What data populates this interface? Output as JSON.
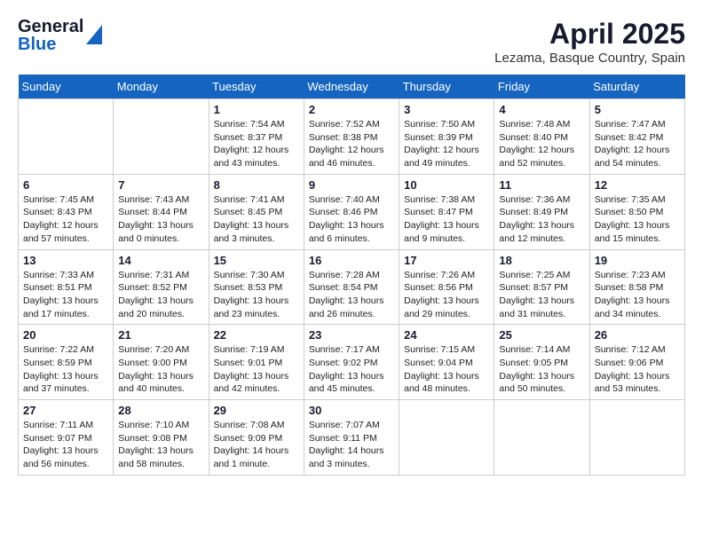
{
  "header": {
    "logo_general": "General",
    "logo_blue": "Blue",
    "month": "April 2025",
    "location": "Lezama, Basque Country, Spain"
  },
  "weekdays": [
    "Sunday",
    "Monday",
    "Tuesday",
    "Wednesday",
    "Thursday",
    "Friday",
    "Saturday"
  ],
  "weeks": [
    [
      {
        "day": "",
        "info": ""
      },
      {
        "day": "",
        "info": ""
      },
      {
        "day": "1",
        "info": "Sunrise: 7:54 AM\nSunset: 8:37 PM\nDaylight: 12 hours and 43 minutes."
      },
      {
        "day": "2",
        "info": "Sunrise: 7:52 AM\nSunset: 8:38 PM\nDaylight: 12 hours and 46 minutes."
      },
      {
        "day": "3",
        "info": "Sunrise: 7:50 AM\nSunset: 8:39 PM\nDaylight: 12 hours and 49 minutes."
      },
      {
        "day": "4",
        "info": "Sunrise: 7:48 AM\nSunset: 8:40 PM\nDaylight: 12 hours and 52 minutes."
      },
      {
        "day": "5",
        "info": "Sunrise: 7:47 AM\nSunset: 8:42 PM\nDaylight: 12 hours and 54 minutes."
      }
    ],
    [
      {
        "day": "6",
        "info": "Sunrise: 7:45 AM\nSunset: 8:43 PM\nDaylight: 12 hours and 57 minutes."
      },
      {
        "day": "7",
        "info": "Sunrise: 7:43 AM\nSunset: 8:44 PM\nDaylight: 13 hours and 0 minutes."
      },
      {
        "day": "8",
        "info": "Sunrise: 7:41 AM\nSunset: 8:45 PM\nDaylight: 13 hours and 3 minutes."
      },
      {
        "day": "9",
        "info": "Sunrise: 7:40 AM\nSunset: 8:46 PM\nDaylight: 13 hours and 6 minutes."
      },
      {
        "day": "10",
        "info": "Sunrise: 7:38 AM\nSunset: 8:47 PM\nDaylight: 13 hours and 9 minutes."
      },
      {
        "day": "11",
        "info": "Sunrise: 7:36 AM\nSunset: 8:49 PM\nDaylight: 13 hours and 12 minutes."
      },
      {
        "day": "12",
        "info": "Sunrise: 7:35 AM\nSunset: 8:50 PM\nDaylight: 13 hours and 15 minutes."
      }
    ],
    [
      {
        "day": "13",
        "info": "Sunrise: 7:33 AM\nSunset: 8:51 PM\nDaylight: 13 hours and 17 minutes."
      },
      {
        "day": "14",
        "info": "Sunrise: 7:31 AM\nSunset: 8:52 PM\nDaylight: 13 hours and 20 minutes."
      },
      {
        "day": "15",
        "info": "Sunrise: 7:30 AM\nSunset: 8:53 PM\nDaylight: 13 hours and 23 minutes."
      },
      {
        "day": "16",
        "info": "Sunrise: 7:28 AM\nSunset: 8:54 PM\nDaylight: 13 hours and 26 minutes."
      },
      {
        "day": "17",
        "info": "Sunrise: 7:26 AM\nSunset: 8:56 PM\nDaylight: 13 hours and 29 minutes."
      },
      {
        "day": "18",
        "info": "Sunrise: 7:25 AM\nSunset: 8:57 PM\nDaylight: 13 hours and 31 minutes."
      },
      {
        "day": "19",
        "info": "Sunrise: 7:23 AM\nSunset: 8:58 PM\nDaylight: 13 hours and 34 minutes."
      }
    ],
    [
      {
        "day": "20",
        "info": "Sunrise: 7:22 AM\nSunset: 8:59 PM\nDaylight: 13 hours and 37 minutes."
      },
      {
        "day": "21",
        "info": "Sunrise: 7:20 AM\nSunset: 9:00 PM\nDaylight: 13 hours and 40 minutes."
      },
      {
        "day": "22",
        "info": "Sunrise: 7:19 AM\nSunset: 9:01 PM\nDaylight: 13 hours and 42 minutes."
      },
      {
        "day": "23",
        "info": "Sunrise: 7:17 AM\nSunset: 9:02 PM\nDaylight: 13 hours and 45 minutes."
      },
      {
        "day": "24",
        "info": "Sunrise: 7:15 AM\nSunset: 9:04 PM\nDaylight: 13 hours and 48 minutes."
      },
      {
        "day": "25",
        "info": "Sunrise: 7:14 AM\nSunset: 9:05 PM\nDaylight: 13 hours and 50 minutes."
      },
      {
        "day": "26",
        "info": "Sunrise: 7:12 AM\nSunset: 9:06 PM\nDaylight: 13 hours and 53 minutes."
      }
    ],
    [
      {
        "day": "27",
        "info": "Sunrise: 7:11 AM\nSunset: 9:07 PM\nDaylight: 13 hours and 56 minutes."
      },
      {
        "day": "28",
        "info": "Sunrise: 7:10 AM\nSunset: 9:08 PM\nDaylight: 13 hours and 58 minutes."
      },
      {
        "day": "29",
        "info": "Sunrise: 7:08 AM\nSunset: 9:09 PM\nDaylight: 14 hours and 1 minute."
      },
      {
        "day": "30",
        "info": "Sunrise: 7:07 AM\nSunset: 9:11 PM\nDaylight: 14 hours and 3 minutes."
      },
      {
        "day": "",
        "info": ""
      },
      {
        "day": "",
        "info": ""
      },
      {
        "day": "",
        "info": ""
      }
    ]
  ]
}
